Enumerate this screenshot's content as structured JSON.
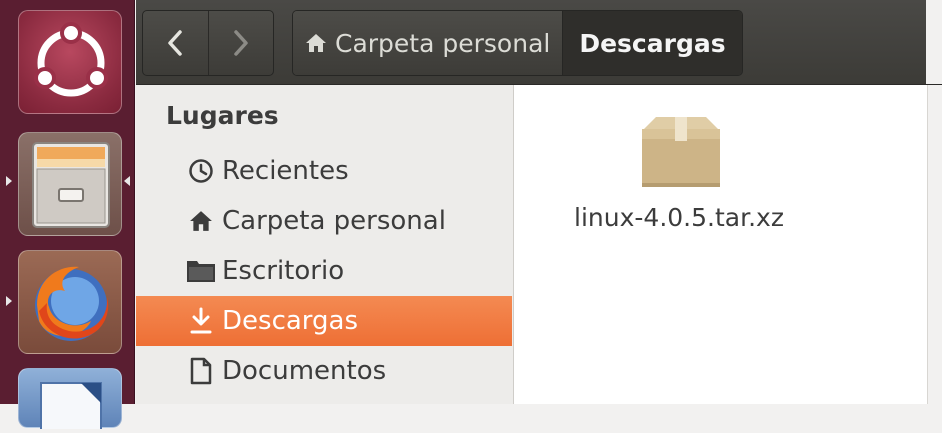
{
  "launcher": {
    "items": [
      {
        "name": "ubuntu-dash-icon"
      },
      {
        "name": "files-icon"
      },
      {
        "name": "firefox-icon"
      },
      {
        "name": "libreoffice-writer-icon"
      }
    ]
  },
  "header": {
    "back_icon": "chevron-left-icon",
    "forward_icon": "chevron-right-icon",
    "breadcrumbs": [
      {
        "label": "Carpeta personal",
        "icon": "home-icon"
      },
      {
        "label": "Descargas"
      }
    ]
  },
  "sidebar": {
    "heading": "Lugares",
    "items": [
      {
        "label": "Recientes",
        "icon": "clock-icon"
      },
      {
        "label": "Carpeta personal",
        "icon": "home-icon"
      },
      {
        "label": "Escritorio",
        "icon": "folder-icon"
      },
      {
        "label": "Descargas",
        "icon": "download-icon",
        "selected": true
      },
      {
        "label": "Documentos",
        "icon": "document-icon"
      }
    ]
  },
  "content": {
    "files": [
      {
        "name": "linux-4.0.5.tar.xz",
        "icon": "package-icon"
      }
    ]
  },
  "colors": {
    "launcher_bg": "#5a1e31",
    "header_bg": "#3c3b37",
    "selection": "#f07746",
    "sidebar_bg": "#edecea"
  }
}
